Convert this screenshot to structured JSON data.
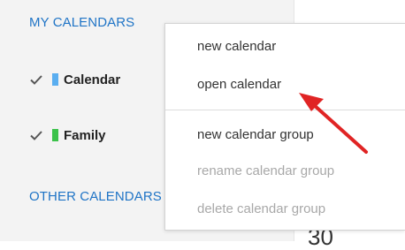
{
  "sidebar": {
    "my_calendars_heading": "MY CALENDARS",
    "calendars": [
      {
        "label": "Calendar",
        "checked": true,
        "color": "#5aaef0"
      },
      {
        "label": "Family",
        "checked": true,
        "color": "#3bc24a"
      }
    ],
    "other_calendars_heading": "OTHER CALENDARS"
  },
  "context_menu": {
    "items": [
      {
        "label": "new calendar",
        "enabled": true
      },
      {
        "label": "open calendar",
        "enabled": true
      },
      {
        "label": "new calendar group",
        "enabled": true
      },
      {
        "label": "rename calendar group",
        "enabled": false
      },
      {
        "label": "delete calendar group",
        "enabled": false
      }
    ]
  },
  "peek": {
    "day_number": "30"
  },
  "annotation": {
    "arrow_color": "#e02424",
    "points_to": "open calendar"
  }
}
